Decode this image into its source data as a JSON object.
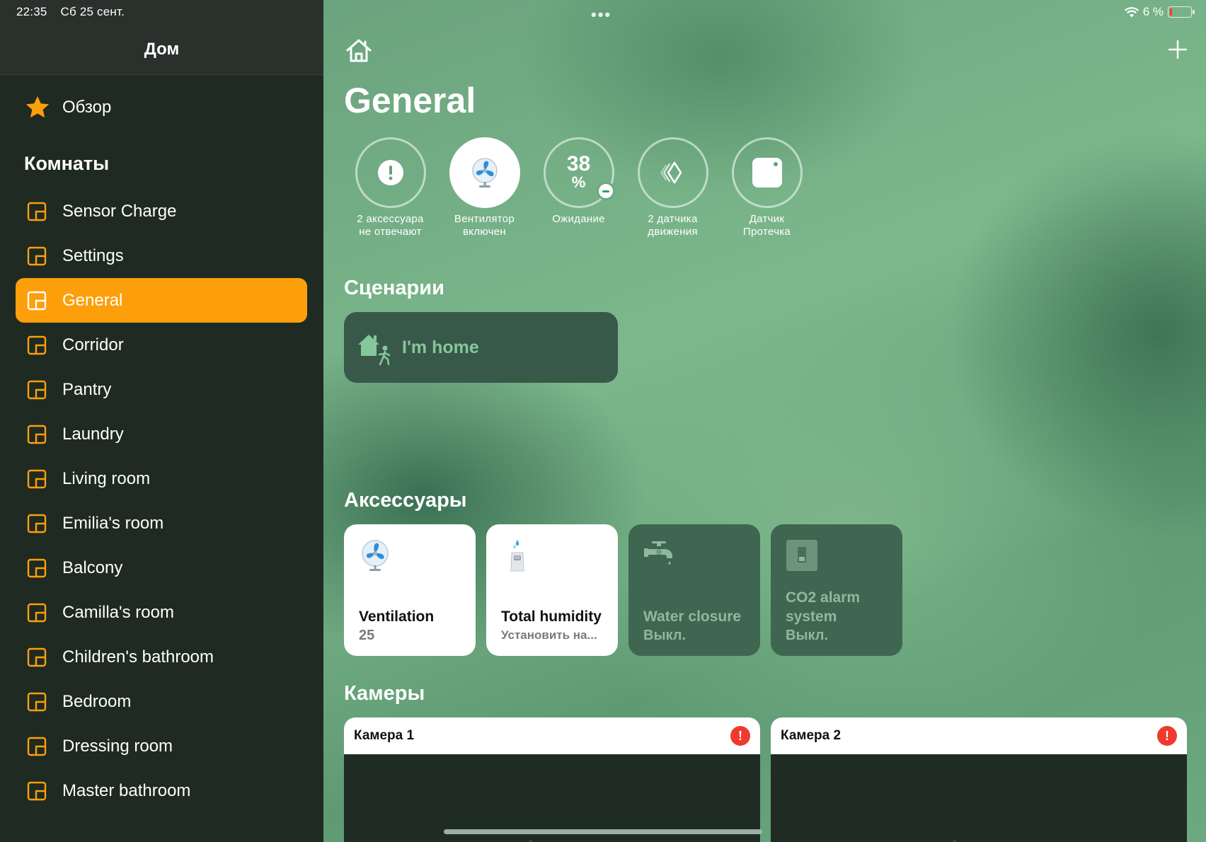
{
  "status_bar": {
    "time": "22:35",
    "date": "Сб 25 сент.",
    "battery": "6 %"
  },
  "sidebar": {
    "title": "Дом",
    "overview_label": "Обзор",
    "rooms_heading": "Комнаты",
    "rooms": [
      {
        "label": "Sensor Charge"
      },
      {
        "label": "Settings"
      },
      {
        "label": "General"
      },
      {
        "label": "Corridor"
      },
      {
        "label": "Pantry"
      },
      {
        "label": "Laundry"
      },
      {
        "label": "Living room"
      },
      {
        "label": "Emilia's room"
      },
      {
        "label": "Balcony"
      },
      {
        "label": "Camilla's room"
      },
      {
        "label": "Children's bathroom"
      },
      {
        "label": "Bedroom"
      },
      {
        "label": "Dressing room"
      },
      {
        "label": "Master bathroom"
      }
    ],
    "active_room": "General",
    "accent_color": "#fd9f0a"
  },
  "main": {
    "title": "General",
    "status": [
      {
        "icon": "exclamation-icon",
        "line1": "2 аксессуара",
        "line2": "не отвечают"
      },
      {
        "icon": "fan-icon",
        "line1": "Вентилятор",
        "line2": "включен"
      },
      {
        "icon": "humidity-percent",
        "value": "38",
        "unit": "%",
        "line1": "Ожидание",
        "line2": ""
      },
      {
        "icon": "motion-sensor-icon",
        "line1": "2 датчика",
        "line2": "движения"
      },
      {
        "icon": "leak-sensor-icon",
        "line1": "Датчик",
        "line2": "Протечка"
      }
    ],
    "scenes_heading": "Сценарии",
    "scenes": [
      {
        "icon": "arrive-home-icon",
        "label": "I'm home"
      }
    ],
    "accessories_heading": "Аксессуары",
    "accessories": [
      {
        "icon": "fan-icon",
        "name": "Ventilation",
        "state": "25",
        "on": true
      },
      {
        "icon": "humidifier-icon",
        "name": "Total humidity",
        "state": "Установить на...",
        "on": true
      },
      {
        "icon": "faucet-icon",
        "name": "Water closure",
        "state": "Выкл.",
        "on": false
      },
      {
        "icon": "switch-icon",
        "name": "CO2 alarm system",
        "state": "Выкл.",
        "on": false
      }
    ],
    "cameras_heading": "Камеры",
    "cameras": [
      {
        "name": "Камера 1",
        "alert": "!"
      },
      {
        "name": "Камера 2",
        "alert": "!"
      }
    ]
  }
}
